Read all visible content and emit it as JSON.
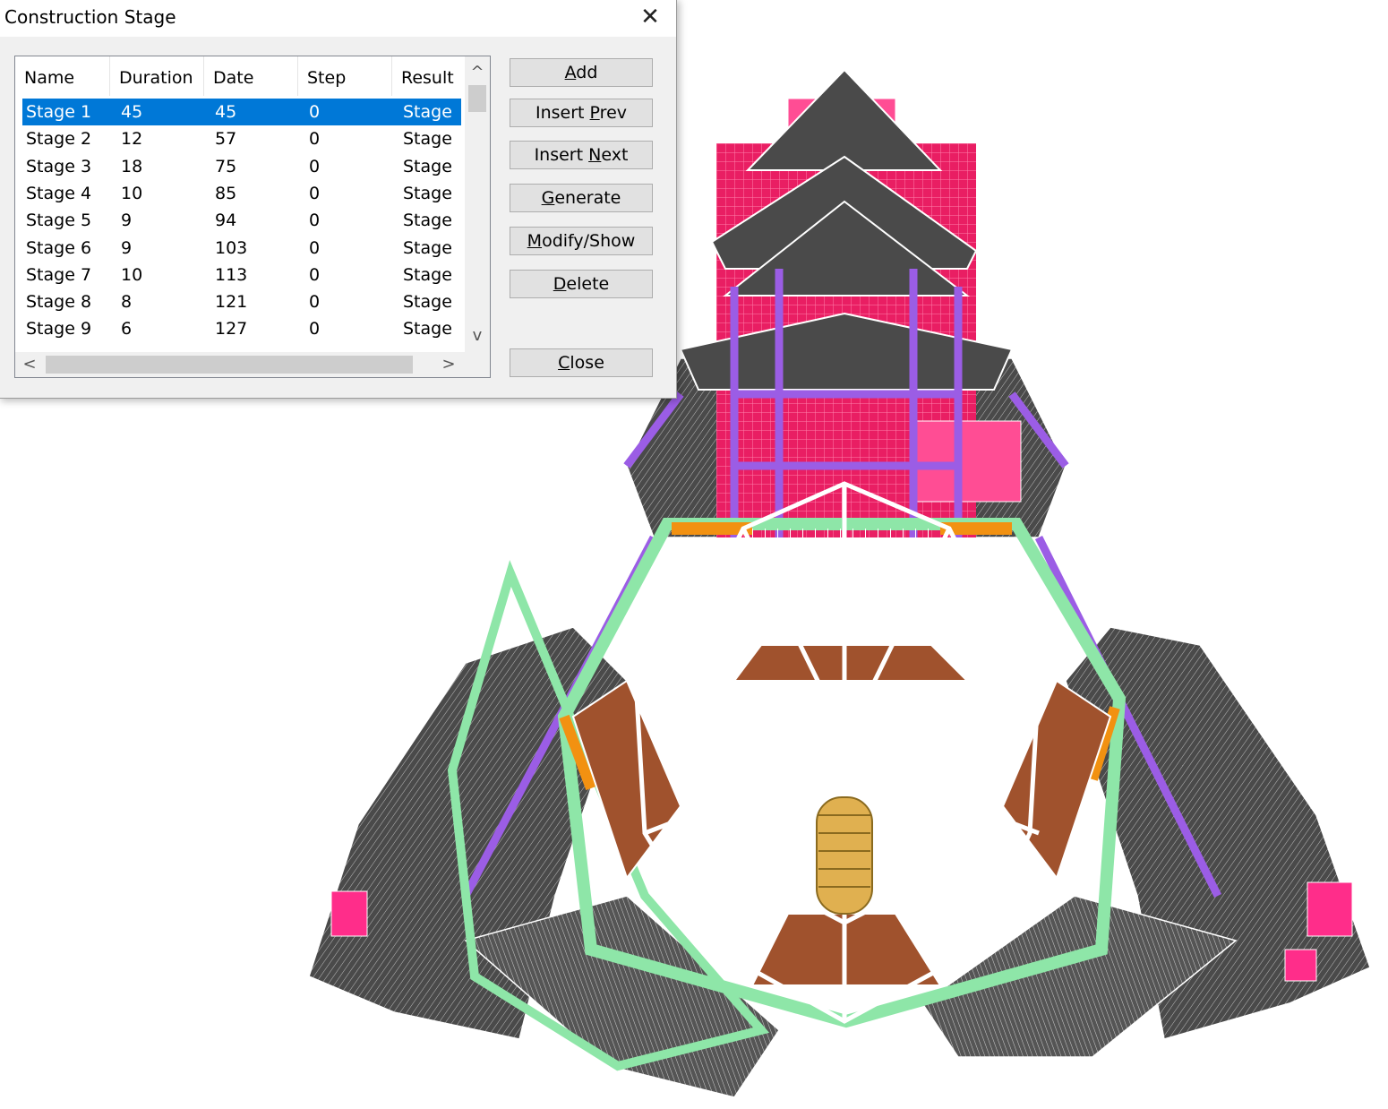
{
  "dialog": {
    "title": "Construction Stage",
    "close_glyph": "✕"
  },
  "list": {
    "columns": [
      "Name",
      "Duration",
      "Date",
      "Step",
      "Result"
    ],
    "rows": [
      {
        "name": "Stage 1",
        "duration": "45",
        "date": "45",
        "step": "0",
        "result": "Stage",
        "selected": true
      },
      {
        "name": "Stage 2",
        "duration": "12",
        "date": "57",
        "step": "0",
        "result": "Stage"
      },
      {
        "name": "Stage 3",
        "duration": "18",
        "date": "75",
        "step": "0",
        "result": "Stage"
      },
      {
        "name": "Stage 4",
        "duration": "10",
        "date": "85",
        "step": "0",
        "result": "Stage"
      },
      {
        "name": "Stage 5",
        "duration": "9",
        "date": "94",
        "step": "0",
        "result": "Stage"
      },
      {
        "name": "Stage 6",
        "duration": "9",
        "date": "103",
        "step": "0",
        "result": "Stage"
      },
      {
        "name": "Stage 7",
        "duration": "10",
        "date": "113",
        "step": "0",
        "result": "Stage"
      },
      {
        "name": "Stage 8",
        "duration": "8",
        "date": "121",
        "step": "0",
        "result": "Stage"
      },
      {
        "name": "Stage 9",
        "duration": "6",
        "date": "127",
        "step": "0",
        "result": "Stage"
      }
    ],
    "scroll": {
      "up_icon": "^",
      "down_icon": "v",
      "left_icon": "<",
      "right_icon": ">"
    }
  },
  "buttons": {
    "add": {
      "pre": "",
      "mnemonic": "A",
      "post": "dd"
    },
    "insert_prev": {
      "pre": "Insert ",
      "mnemonic": "P",
      "post": "rev"
    },
    "insert_next": {
      "pre": "Insert ",
      "mnemonic": "N",
      "post": "ext"
    },
    "generate": {
      "pre": "",
      "mnemonic": "G",
      "post": "enerate"
    },
    "modify_show": {
      "pre": "",
      "mnemonic": "M",
      "post": "odify/Show"
    },
    "delete": {
      "pre": "",
      "mnemonic": "D",
      "post": "elete"
    },
    "close": {
      "pre": "",
      "mnemonic": "C",
      "post": "lose"
    }
  },
  "model": {
    "colors": {
      "shell_dark": "#4a4a4a",
      "member_purple": "#9b5de5",
      "member_dark_purple": "#3d1a6e",
      "pink": "#ff2d8a",
      "magenta": "#d81b60",
      "green": "#8ee6a8",
      "dark_green": "#2e8b57",
      "orange": "#f29111",
      "brown": "#a0522d",
      "white_frame": "#ffffff",
      "core": "#e0b050"
    }
  }
}
